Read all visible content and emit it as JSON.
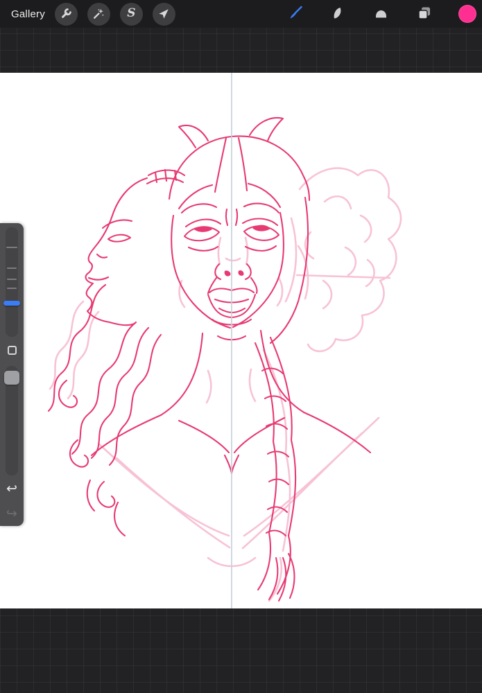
{
  "topbar": {
    "gallery_label": "Gallery",
    "tools_left": [
      {
        "name": "actions",
        "icon": "wrench-icon"
      },
      {
        "name": "adjustments",
        "icon": "magic-wand-icon"
      },
      {
        "name": "selection",
        "icon": "selection-s-icon",
        "glyph": "S"
      },
      {
        "name": "transform",
        "icon": "transform-arrow-icon"
      }
    ],
    "tools_right": [
      {
        "name": "paint",
        "icon": "brush-icon",
        "active": true
      },
      {
        "name": "smudge",
        "icon": "smudge-icon"
      },
      {
        "name": "erase",
        "icon": "eraser-icon"
      },
      {
        "name": "layers",
        "icon": "layers-icon"
      },
      {
        "name": "color",
        "icon": "color-swatch"
      }
    ]
  },
  "sidebar": {
    "brush_size_slider": "brush-size",
    "opacity_slider": "opacity",
    "modify_button": "modify",
    "undo_glyph": "↩",
    "redo_glyph": "↪"
  },
  "canvas": {
    "content": "pink sketch of two female faces, one front view looking up and one profile, with long wavy hair and a braid",
    "symmetry_guide": "vertical"
  },
  "colors": {
    "accent_blue": "#3a7df7",
    "swatch_pink": "#ff2f92",
    "sketch_pink": "#e73a72",
    "sketch_pink_light": "#f7bcd2",
    "symmetry_line": "#c7d0de",
    "topbar_bg": "#1c1c1e",
    "grid_bg": "#222224",
    "sidebar_bg": "#4e4e50"
  }
}
